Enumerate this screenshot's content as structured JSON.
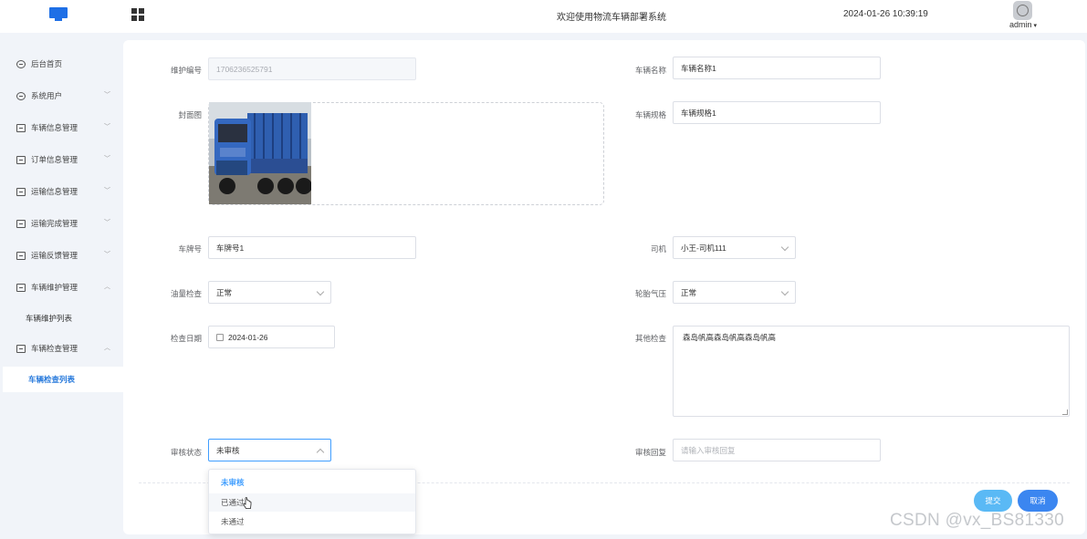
{
  "header": {
    "welcome": "欢迎使用物流车辆部署系统",
    "datetime": "2024-01-26 10:39:19",
    "user": "admin",
    "logo_icon": "monitor-icon",
    "menu_icon": "grid-icon"
  },
  "sidebar": {
    "items": [
      {
        "label": "后台首页",
        "icon": "clock-icon"
      },
      {
        "label": "系统用户",
        "icon": "user-icon"
      },
      {
        "label": "车辆信息管理",
        "icon": "form-icon"
      },
      {
        "label": "订单信息管理",
        "icon": "form-icon"
      },
      {
        "label": "运输信息管理",
        "icon": "form-icon"
      },
      {
        "label": "运输完成管理",
        "icon": "form-icon"
      },
      {
        "label": "运输反馈管理",
        "icon": "form-icon"
      },
      {
        "label": "车辆维护管理",
        "icon": "form-icon"
      },
      {
        "label": "车辆维护列表"
      },
      {
        "label": "车辆检查管理",
        "icon": "form-icon"
      },
      {
        "label": "车辆检查列表"
      }
    ]
  },
  "form": {
    "maint_no_label": "维护编号",
    "maint_no_value": "1706236525791",
    "vehicle_name_label": "车辆名称",
    "vehicle_name_value": "车辆名称1",
    "cover_label": "封面图",
    "vehicle_spec_label": "车辆规格",
    "vehicle_spec_value": "车辆规格1",
    "plate_label": "车牌号",
    "plate_value": "车牌号1",
    "driver_label": "司机",
    "driver_value": "小王-司机111",
    "oil_label": "油量检查",
    "oil_value": "正常",
    "tire_label": "轮胎气压",
    "tire_value": "正常",
    "date_label": "检查日期",
    "date_value": "2024-01-26",
    "other_label": "其他检查",
    "other_value": "森岛帆高森岛帆高森岛帆高",
    "audit_status_label": "审核状态",
    "audit_status_value": "未审核",
    "audit_reply_label": "审核回复",
    "audit_reply_placeholder": "请输入审核回复"
  },
  "dropdown": {
    "options": [
      "未审核",
      "已通过",
      "未通过"
    ],
    "selected": "未审核",
    "hovered": "已通过"
  },
  "buttons": {
    "submit": "提交",
    "cancel": "取消"
  },
  "colors": {
    "accent": "#409eff",
    "submit_bg": "#5ab9f5",
    "cancel_bg": "#3b86f0",
    "active_menu": "#2a7bdc"
  },
  "watermark": "CSDN @vx_BS81330"
}
